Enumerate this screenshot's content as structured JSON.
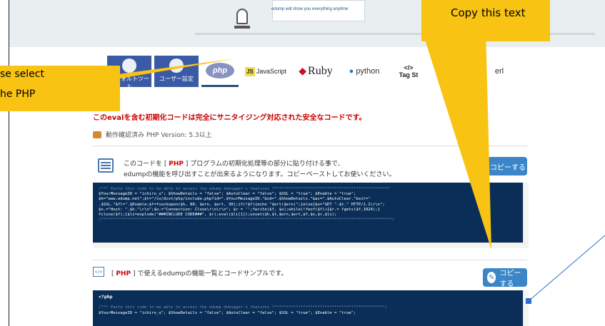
{
  "banner": {
    "tagline": "edump will show you everything anytime"
  },
  "tabs": {
    "tool": "デフォルトツール",
    "user": "ユーザー設定",
    "php": "php",
    "js_badge": "JS",
    "js": "JavaScript",
    "ruby": "Ruby",
    "python": "python",
    "tag_icon": "</>",
    "tag": "Tag St",
    "perl": "erl"
  },
  "notice": {
    "warning": "このevalを含む初期化コードは完全にサニタイジング対応された安全なコードです。",
    "version": "動作確認済み  PHP Version: 5.3以上"
  },
  "section1": {
    "line1_pre": "このコードを [ ",
    "lang": "PHP",
    "line1_post": " ] プログラムの初期化処理等の部分に貼り付ける事で、",
    "line2": "edumpの機能を呼び出すことが出来るようになります。コピーペーストしてお使いください。",
    "copy_label": "コピーする"
  },
  "code1": {
    "comment_top": "/*** Paste this code to be able to access the edump debugger's features *************************************************",
    "line1": "$YourMessageID = \"ichiro_u\"; $ShowDetails = \"false\"; $AutoClear = \"false\"; $SSL = \"true\"; $Enable = \"true\";",
    "line2": "$h=\"www.edump.net\";$t=\"/sv/dist/php/include.php?id=\".$YourMessageID.\"&sd=\".$ShowDetails.\"&ac=\".$AutoClear.\"&ssl=\"",
    "line3": ".$SSL.\"&fl=\".$Enable;$f=fsockopen($h, 80, $ern, $ert, 30);if(!$f){echo \"$ert($ern)\";}else{$o=\"GET \".$t.\" HTTP/1.1\\r\\n\";",
    "line4": "$o.=\"Host: \".$h.\"\\r\\n\";$o.=\"Connection: Close\\r\\n\\r\\n\"; $r = '';fwrite($f, $o);while(!feof($f)){$r.= fgets($f,1024);}",
    "line5": "fclose($f);}$li=explode(\"###INCLUDE CODE###\", $r);eval($li[1]);unset($h,$t,$ern,$ert,$f,$o,$r,$li);",
    "comment_bottom": "/*************************************************************************************************************************/"
  },
  "section2": {
    "icon": "</>",
    "text_pre": "[ ",
    "lang": "PHP",
    "text_post": " ] で使えるedumpの機能一覧とコードサンプルです。",
    "copy_label": "コピーする"
  },
  "code2": {
    "open_tag": "<?php",
    "comment": "/*** Paste this code to be able to access the edump debugger's features ***********************************************/",
    "line1": "$YourMessageID = \"ichiro_u\"; $ShowDetails = \"false\"; $AutoClear = \"false\"; $SSL = \"true\"; $Enable = \"true\";"
  },
  "callouts": {
    "right": "Copy this text",
    "left_line1": "se select",
    "left_line2": "he PHP"
  },
  "colors": {
    "callout": "#f9c314",
    "code_bg": "#0a2e57",
    "accent": "#3a86c8",
    "warning": "#cc0000"
  }
}
